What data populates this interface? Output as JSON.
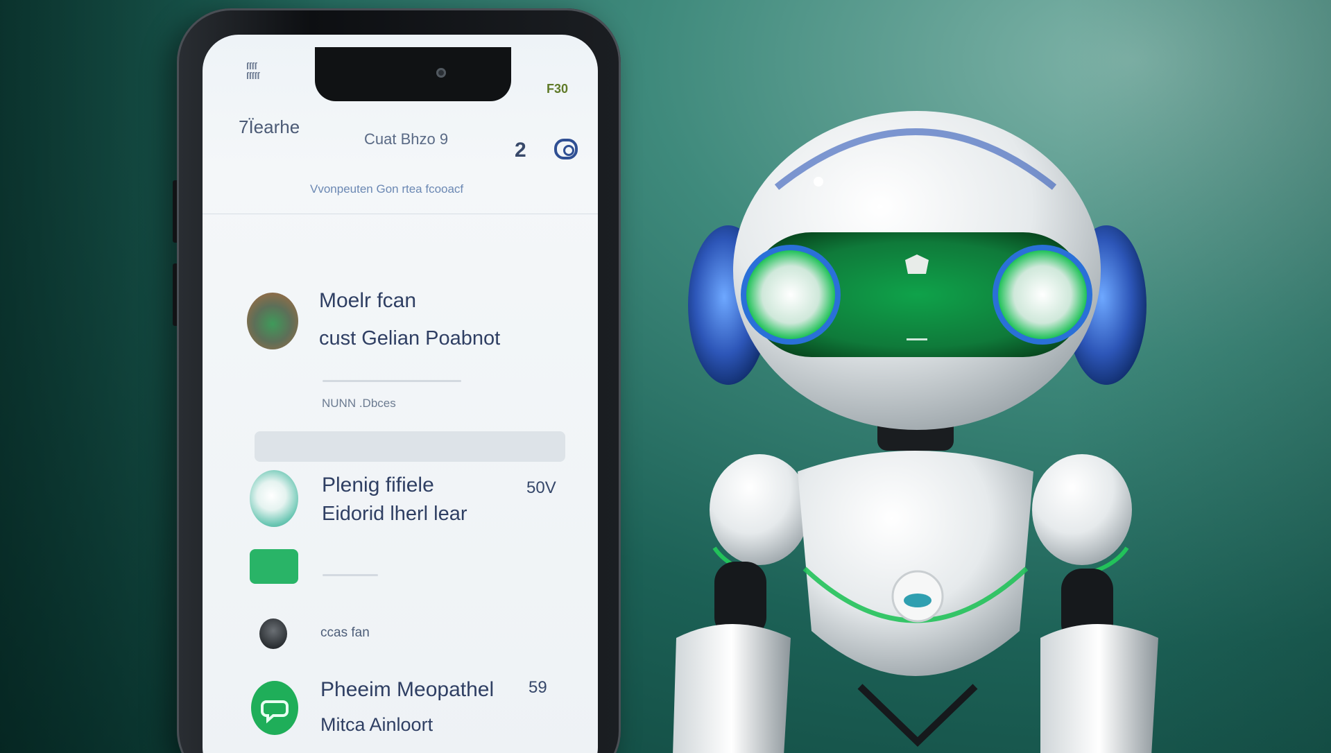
{
  "phone": {
    "status_left": "ſſſſ\nſſſſſ",
    "status_right": "F30",
    "nav_title": "7Ïearhe",
    "nav_center": "Cuat Bhzo 9",
    "nav_count": "2",
    "nav_icon": "chat-refresh-icon",
    "subtitle": "Vvonpeuten Gon rtea fcooacf",
    "rows": [
      {
        "title": "Moelr fcan",
        "subtitle": "cust Gelian Poabnot",
        "small": "NUNN .Dbces",
        "value": ""
      },
      {
        "title": "Plenig fifiele",
        "subtitle": "Eidorid lherl lear",
        "small": "",
        "value": "50V"
      },
      {
        "title": "",
        "subtitle": "",
        "small": "ccas fan",
        "value": ""
      },
      {
        "title": "Pheeim Meopathel",
        "subtitle": "Mitca Ainloort",
        "small": "",
        "value": "59"
      }
    ]
  },
  "colors": {
    "background": "#1c6156",
    "robot_visor": "#0f7a3a",
    "accent_blue": "#2d56b8",
    "accent_green": "#29b467"
  }
}
